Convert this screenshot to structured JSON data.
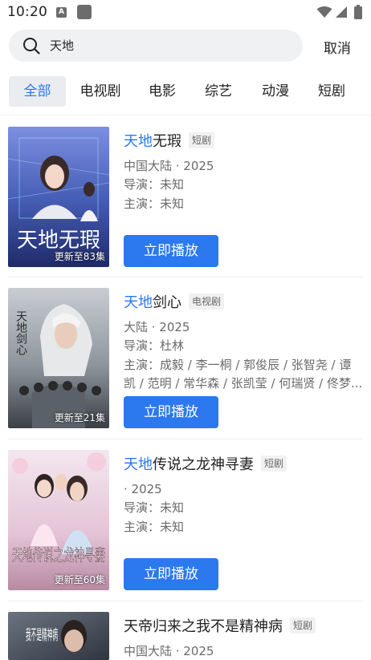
{
  "status_bar": {
    "time": "10:20",
    "notif_a": "A"
  },
  "search": {
    "query": "天地",
    "cancel_label": "取消"
  },
  "tabs": [
    {
      "label": "全部",
      "active": true
    },
    {
      "label": "电视剧",
      "active": false
    },
    {
      "label": "电影",
      "active": false
    },
    {
      "label": "综艺",
      "active": false
    },
    {
      "label": "动漫",
      "active": false
    },
    {
      "label": "短剧",
      "active": false
    }
  ],
  "results": [
    {
      "title_highlight": "天地",
      "title_rest": "无瑕",
      "tag": "短剧",
      "region_year": "中国大陆 · 2025",
      "director": "导演：未知",
      "cast": "主演：未知",
      "badge": "更新至83集",
      "play_label": "立即播放",
      "poster_text": "天地无瑕"
    },
    {
      "title_highlight": "天地",
      "title_rest": "剑心",
      "tag": "电视剧",
      "region_year": "大陆 · 2025",
      "director": "导演：杜林",
      "cast": "主演：成毅 / 李一桐 / 郭俊辰 / 张智尧 / 谭凯 / 范明 / 常华森 / 张凯莹 / 何瑞贤 / 佟梦...",
      "badge": "更新至21集",
      "play_label": "立即播放",
      "poster_text": "天地剑心"
    },
    {
      "title_highlight": "天地",
      "title_rest": "传说之龙神寻妻",
      "tag": "短剧",
      "region_year": " · 2025",
      "director": "导演：未知",
      "cast": "主演：未知",
      "badge": "更新至60集",
      "play_label": "立即播放",
      "poster_text": "天地传说之龙神寻妻"
    },
    {
      "title_highlight": "",
      "title_rest": "天帝归来之我不是精神病",
      "tag": "短剧",
      "region_year": "中国大陆 · 2025",
      "poster_text": "我不是精神病"
    }
  ],
  "colors": {
    "accent": "#2b78ef",
    "tab_active_bg": "#eaecef"
  },
  "icons": [
    "search-icon",
    "wifi-icon",
    "signal-icon",
    "battery-icon"
  ]
}
